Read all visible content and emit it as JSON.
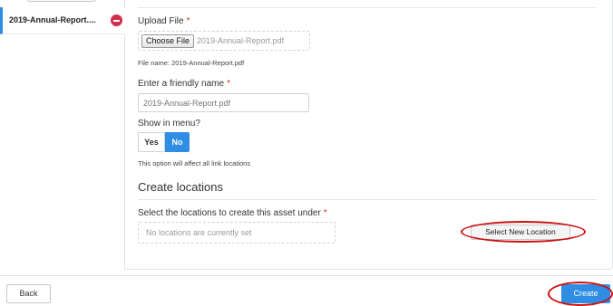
{
  "sidebar": {
    "file_item_label": "2019-Annual-Report...."
  },
  "upload": {
    "label": "Upload File",
    "required_mark": "*",
    "choose_button": "Choose File",
    "chosen_file": "2019-Annual-Report.pdf",
    "file_name_note": "File name: 2019-Annual-Report.pdf"
  },
  "friendly_name": {
    "label": "Enter a friendly name",
    "required_mark": "*",
    "placeholder": "2019-Annual-Report.pdf"
  },
  "show_in_menu": {
    "label": "Show in menu?",
    "yes_label": "Yes",
    "no_label": "No",
    "selected": "No",
    "note": "This option will affect all link locations"
  },
  "locations": {
    "section_title": "Create locations",
    "select_label": "Select the locations to create this asset under",
    "required_mark": "*",
    "empty_text": "No locations are currently set",
    "select_button": "Select New Location"
  },
  "footer": {
    "back_label": "Back",
    "create_label": "Create"
  },
  "colors": {
    "accent": "#2f8de4",
    "remove": "#d0304b",
    "annotation": "#cc1111"
  }
}
